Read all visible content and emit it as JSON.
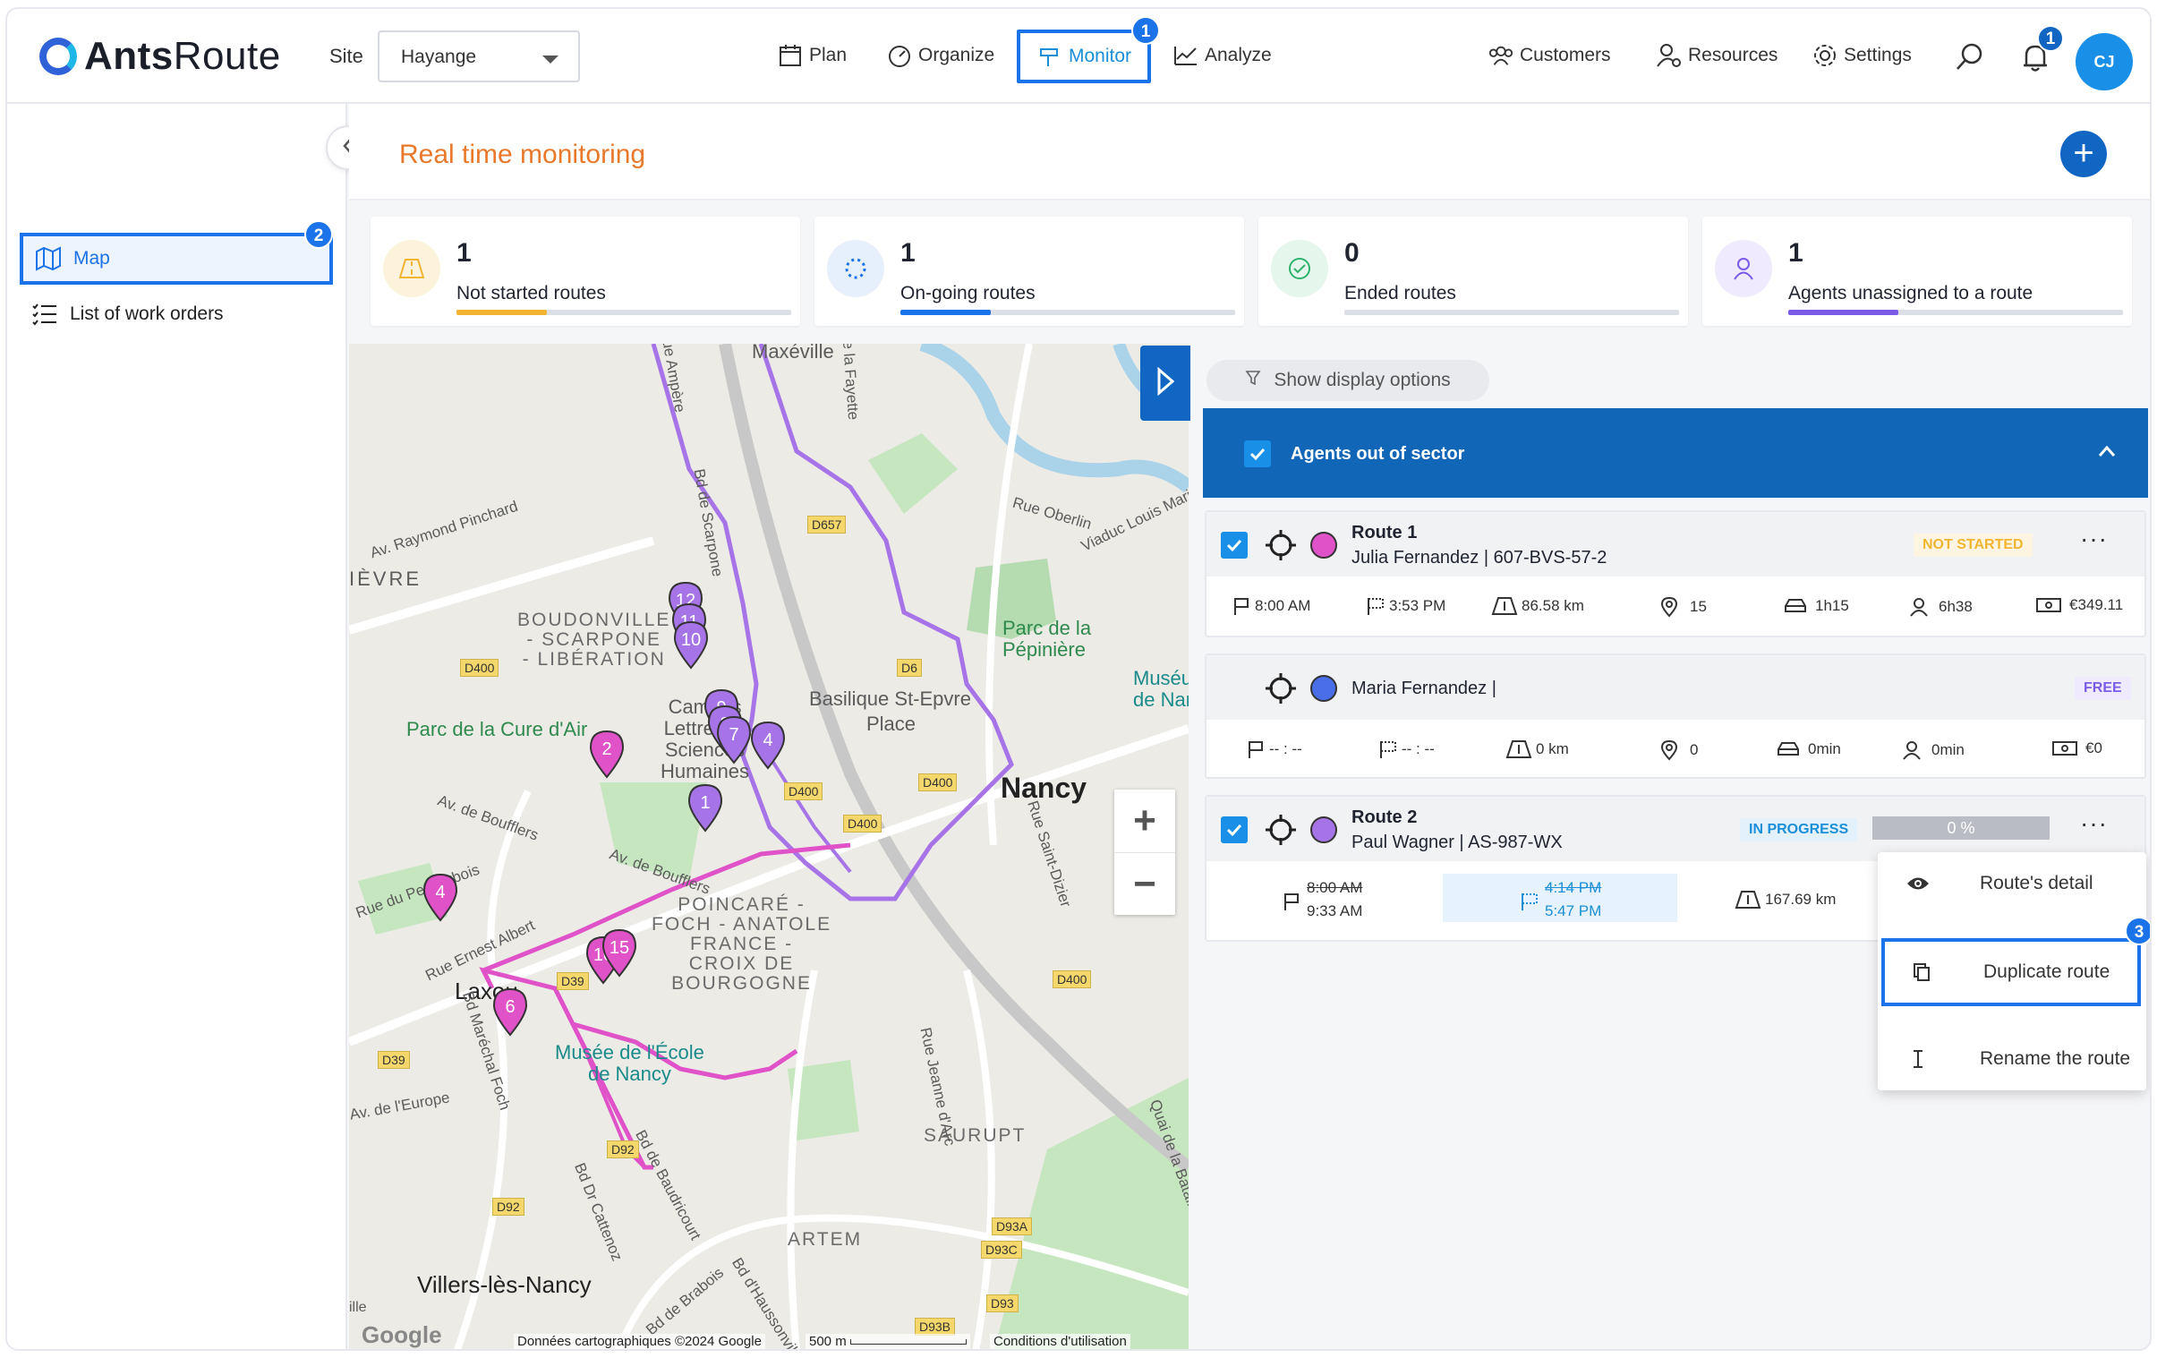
{
  "app": {
    "logo_bold": "Ants",
    "logo_light": "Route"
  },
  "site": {
    "label": "Site",
    "value": "Hayange"
  },
  "nav": {
    "plan": "Plan",
    "organize": "Organize",
    "monitor": "Monitor",
    "analyze": "Analyze",
    "customers": "Customers",
    "resources": "Resources",
    "settings": "Settings"
  },
  "notifications_count": "1",
  "user_initials": "CJ",
  "steps": {
    "one": "1",
    "two": "2",
    "three": "3"
  },
  "sidebar": {
    "items": [
      {
        "label": "Map",
        "active": true
      },
      {
        "label": "List of work orders",
        "active": false
      }
    ]
  },
  "page": {
    "title": "Real time monitoring",
    "add_label": "+"
  },
  "kpis": [
    {
      "value": "1",
      "label": "Not started routes",
      "color": "#f2b531",
      "fill": 0.27
    },
    {
      "value": "1",
      "label": "On-going routes",
      "color": "#1a73e8",
      "fill": 0.27
    },
    {
      "value": "0",
      "label": "Ended routes",
      "color": "#2fb36b",
      "fill": 0
    },
    {
      "value": "1",
      "label": "Agents unassigned to a route",
      "color": "#7b5ce8",
      "fill": 0.33
    }
  ],
  "map": {
    "places": {
      "maxeville": "Maxéville",
      "boudonville": "BOUDONVILLE\n- SCARPONE\n- LIBÉRATION",
      "parc_cure": "Parc de la Cure d'Air",
      "campus": "Campus\nLettres et\nSciences\nHumaines",
      "basilique": "Basilique St-Epvre",
      "place": "Place",
      "nancy": "Nancy",
      "pepiniere": "Parc de la\nPépinière",
      "museum": "Muséum\nde Nancy",
      "poincare": "POINCARÉ -\nFOCH - ANATOLE\nFRANCE -\nCROIX DE\nBOURGOGNE",
      "laxou": "Laxou",
      "musee_ecole": "Musée de l'École\nde Nancy",
      "saurupt": "SAURUPT",
      "artem": "ARTEM",
      "villers": "Villers-lès-Nancy",
      "ievre": "IÈVRE",
      "av_raymond": "Av. Raymond Pinchard",
      "av_boufflers": "Av. de Boufflers",
      "av_boufflers2": "Av. de Boufflers",
      "rue_arbois": "Rue du Petit Arbois",
      "rue_albert": "Rue Ernest Albert",
      "av_europe": "Av. de l'Europe",
      "rue_oberlin": "Rue Oberlin",
      "viaduc": "Viaduc Louis Marin",
      "rue_dizier": "Rue Saint-Dizier",
      "rue_jeanne": "Rue Jeanne d'Arc",
      "bd_foch": "Bd Maréchal Foch",
      "bd_cattenoz": "Bd Dr Cattenoz",
      "bd_baudricourt": "Bd de Baudricourt",
      "quai_bazin": "Quai de la Bataille",
      "bd_scarpone": "Bd de Scarpone",
      "rue_fayette": "Rue la Fayette",
      "rue_ampere": "Rue Ampère",
      "bd_brabois": "Bd de Brabois",
      "bd_haut": "Bd d'Haussonville",
      "ville": "ille"
    },
    "roads": [
      "D657",
      "D400",
      "D400",
      "D400",
      "D400",
      "D400",
      "D39",
      "D39",
      "D92",
      "D92",
      "D93A",
      "D93C",
      "D93",
      "D93B",
      "D6"
    ],
    "markers_purple": [
      "12",
      "11",
      "10",
      "9",
      "8",
      "7",
      "4",
      "1"
    ],
    "markers_pink": [
      "2",
      "4",
      "6",
      "10",
      "15"
    ],
    "attribution": {
      "google": "Google",
      "data": "Données cartographiques ©2024 Google",
      "scale": "500 m",
      "terms": "Conditions d'utilisation"
    }
  },
  "panel": {
    "display_options": "Show display options",
    "sector": "Agents out of sector",
    "routes": [
      {
        "title": "Route 1",
        "agent": "Julia Fernandez | 607-BVS-57-2",
        "status": "NOT STARTED",
        "color": "#e052c8",
        "stats": {
          "start": "8:00 AM",
          "end": "3:53 PM",
          "distance": "86.58 km",
          "stops": "15",
          "drive": "1h15",
          "work": "6h38",
          "cost": "€349.11"
        }
      },
      {
        "title": "",
        "agent": "Maria Fernandez |",
        "status": "FREE",
        "color": "#4a6ee8",
        "stats": {
          "start": "-- : --",
          "end": "-- : --",
          "distance": "0 km",
          "stops": "0",
          "drive": "0min",
          "work": "0min",
          "cost": "€0"
        }
      },
      {
        "title": "Route 2",
        "agent": "Paul Wagner | AS-987-WX",
        "status": "IN PROGRESS",
        "progress": "0 %",
        "color": "#a774e8",
        "stats": {
          "start_planned": "8:00 AM",
          "start_actual": "9:33 AM",
          "end_planned": "4:14 PM",
          "end_actual": "5:47 PM",
          "distance": "167.69 km"
        }
      }
    ]
  },
  "menu": {
    "detail": "Route's detail",
    "duplicate": "Duplicate route",
    "rename": "Rename the route"
  }
}
